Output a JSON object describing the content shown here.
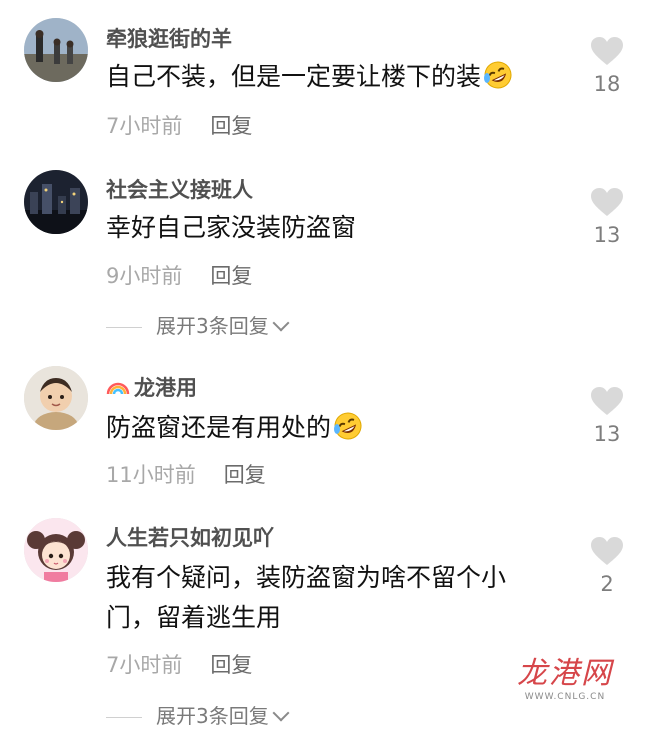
{
  "comments": [
    {
      "username": "牵狼逛街的羊",
      "text": "自己不装，但是一定要让楼下的装",
      "has_emoji": true,
      "emoji_icon": "rofl-emoji",
      "time": "7小时前",
      "reply_label": "回复",
      "likes": "18",
      "expand_label": ""
    },
    {
      "username": "社会主义接班人",
      "text": "幸好自己家没装防盗窗",
      "has_emoji": false,
      "time": "9小时前",
      "reply_label": "回复",
      "likes": "13",
      "expand_label": "展开3条回复"
    },
    {
      "username": "龙港用",
      "username_badge": "rainbow-icon",
      "text": "防盗窗还是有用处的",
      "has_emoji": true,
      "emoji_icon": "rofl-emoji",
      "time": "11小时前",
      "reply_label": "回复",
      "likes": "13",
      "expand_label": ""
    },
    {
      "username": "人生若只如初见吖",
      "text_line1": "我有个疑问，装防盗窗为啥不留个小",
      "text_line2": "门，留着逃生用",
      "has_emoji": false,
      "time": "7小时前",
      "reply_label": "回复",
      "likes": "2",
      "expand_label": "展开3条回复"
    }
  ],
  "watermark": {
    "logo_text": "龙港网",
    "url_text": "WWW.CNLG.CN"
  },
  "colors": {
    "accent_watermark": "#d6464a",
    "heart": "#d9d9d9",
    "text": "#111111",
    "meta": "#a8a8a8"
  }
}
